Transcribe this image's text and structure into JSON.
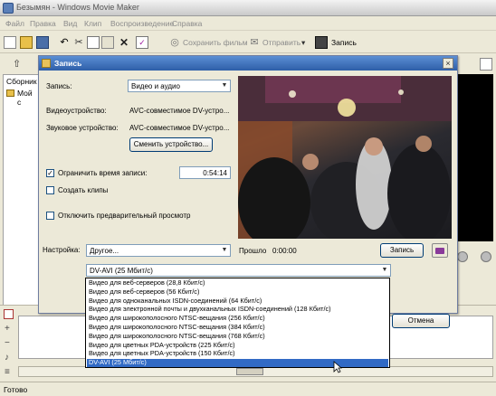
{
  "window": {
    "title": "Безымян - Windows Movie Maker"
  },
  "menu": [
    "Файл",
    "Правка",
    "Вид",
    "Клип",
    "Воспроизведение",
    "Справка"
  ],
  "toolbar": {
    "save_movie": "Сохранить фильм",
    "send": "Отправить",
    "record": "Запись"
  },
  "left_pane": {
    "header": "Сборник",
    "item": "Мой с"
  },
  "status": {
    "text": "Готово"
  },
  "dialog": {
    "title": "Запись",
    "record_label": "Запись:",
    "record_value": "Видео и аудио",
    "video_device_label": "Видеоустройство:",
    "video_device_value": "AVC-совместимое DV-устро...",
    "audio_device_label": "Звуковое устройство:",
    "audio_device_value": "AVC-совместимое DV-устро...",
    "change_device_button": "Сменить устройство...",
    "limit_time_label": "Ограничить время записи:",
    "limit_time_checked": true,
    "limit_time_value": "0:54:14",
    "create_clips_label": "Создать клипы",
    "create_clips_checked": false,
    "disable_preview_label": "Отключить предварительный просмотр",
    "disable_preview_checked": false,
    "settings_label": "Настройка:",
    "settings_value": "Другое...",
    "elapsed_label": "Прошло",
    "elapsed_value": "0:00:00",
    "record_button": "Запись",
    "format_value": "DV-AVI (25 Мбит/с)",
    "cancel_button": "Отмена"
  },
  "dropdown": {
    "options": [
      "Видео для веб-серверов (28,8 Кбит/с)",
      "Видео для веб-серверов (56 Кбит/с)",
      "Видео для одноканальных ISDN-соединений (64 Кбит/с)",
      "Видео для электронной почты и двухканальных ISDN-соединений (128 Кбит/с)",
      "Видео для широкополосного NTSC-вещания (256 Кбит/с)",
      "Видео для широкополосного NTSC-вещания (384 Кбит/с)",
      "Видео для широкополосного NTSC-вещания (768 Кбит/с)",
      "Видео для цветных PDA-устройств (225 Кбит/с)",
      "Видео для цветных PDA-устройств (150 Кбит/с)",
      "DV-AVI (25 Мбит/с)"
    ],
    "selected_index": 9
  },
  "colors": {
    "accent": "#316ac5",
    "titlebar": "#2e5ea8"
  }
}
